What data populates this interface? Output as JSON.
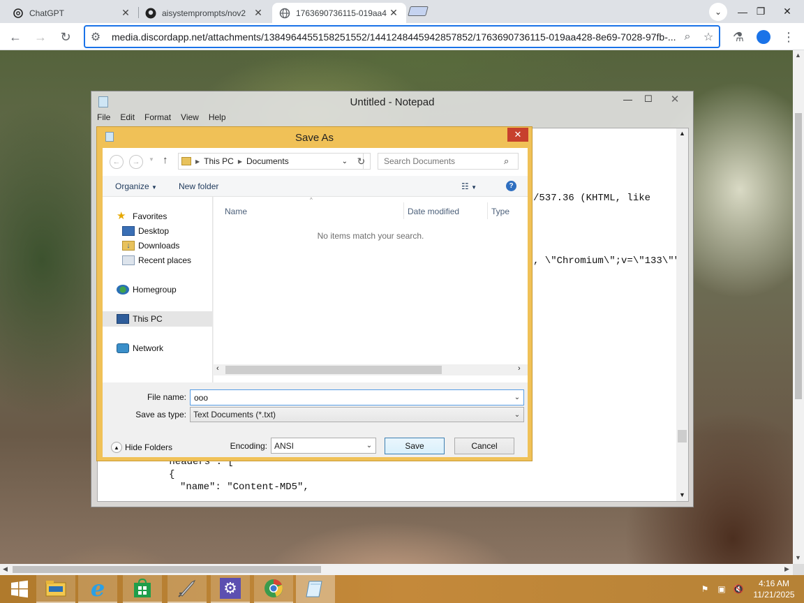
{
  "browser": {
    "tabs": [
      {
        "title": "ChatGPT",
        "icon": "openai-icon",
        "active": false
      },
      {
        "title": "aisystemprompts/nov2",
        "icon": "github-icon",
        "active": false
      },
      {
        "title": "1763690736115-019aa4",
        "icon": "globe-icon",
        "active": true
      }
    ],
    "url": "media.discordapp.net/attachments/1384964455158251552/1441248445942857852/1763690736115-019aa428-8e69-7028-97fb-..."
  },
  "notepad": {
    "title": "Untitled - Notepad",
    "menu": [
      "File",
      "Edit",
      "Format",
      "View",
      "Help"
    ],
    "lines": [
      "/537.36 (KHTML, like",
      ", \\\"Chromium\\\";v=\\\"133\\\"\"",
      "\"headers\": [",
      "{",
      "\"name\": \"Content-MD5\","
    ]
  },
  "save_as": {
    "title": "Save As",
    "breadcrumb": [
      "This PC",
      "Documents"
    ],
    "search_placeholder": "Search Documents",
    "organize": "Organize",
    "new_folder": "New folder",
    "nav": {
      "favorites": "Favorites",
      "desktop": "Desktop",
      "downloads": "Downloads",
      "recent": "Recent places",
      "homegroup": "Homegroup",
      "thispc": "This PC",
      "network": "Network"
    },
    "columns": [
      "Name",
      "Date modified",
      "Type"
    ],
    "empty_message": "No items match your search.",
    "file_name_label": "File name:",
    "file_name_value": "ooo",
    "save_type_label": "Save as type:",
    "save_type_value": "Text Documents (*.txt)",
    "hide_folders": "Hide Folders",
    "encoding_label": "Encoding:",
    "encoding_value": "ANSI",
    "save_button": "Save",
    "cancel_button": "Cancel"
  },
  "taskbar": {
    "apps": [
      "start-button",
      "file-explorer",
      "internet-explorer",
      "store",
      "rocket-app",
      "settings",
      "chrome",
      "notepad"
    ],
    "time": "4:16 AM",
    "date": "11/21/2025"
  },
  "colors": {
    "dialog_frame": "#f0c157",
    "taskbar": "#c4893a",
    "omnibox_focus": "#1a73e8"
  }
}
